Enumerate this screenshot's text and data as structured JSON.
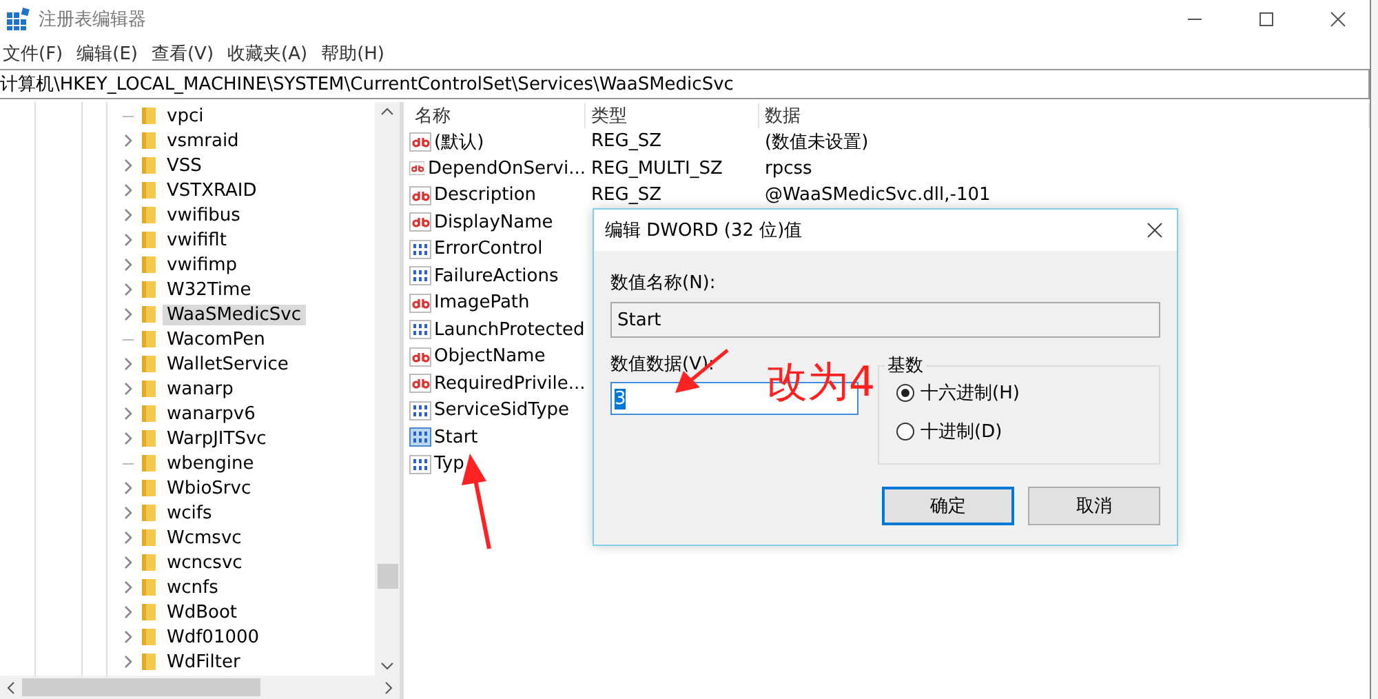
{
  "window": {
    "title": "注册表编辑器"
  },
  "menu": [
    "文件(F)",
    "编辑(E)",
    "查看(V)",
    "收藏夹(A)",
    "帮助(H)"
  ],
  "address": "计算机\\HKEY_LOCAL_MACHINE\\SYSTEM\\CurrentControlSet\\Services\\WaaSMedicSvc",
  "tree": [
    {
      "label": "vpci",
      "expandable": false,
      "selected": false
    },
    {
      "label": "vsmraid",
      "expandable": true,
      "selected": false
    },
    {
      "label": "VSS",
      "expandable": true,
      "selected": false
    },
    {
      "label": "VSTXRAID",
      "expandable": true,
      "selected": false
    },
    {
      "label": "vwifibus",
      "expandable": true,
      "selected": false
    },
    {
      "label": "vwififlt",
      "expandable": true,
      "selected": false
    },
    {
      "label": "vwifimp",
      "expandable": true,
      "selected": false
    },
    {
      "label": "W32Time",
      "expandable": true,
      "selected": false
    },
    {
      "label": "WaaSMedicSvc",
      "expandable": true,
      "selected": true
    },
    {
      "label": "WacomPen",
      "expandable": false,
      "selected": false
    },
    {
      "label": "WalletService",
      "expandable": true,
      "selected": false
    },
    {
      "label": "wanarp",
      "expandable": true,
      "selected": false
    },
    {
      "label": "wanarpv6",
      "expandable": true,
      "selected": false
    },
    {
      "label": "WarpJITSvc",
      "expandable": true,
      "selected": false
    },
    {
      "label": "wbengine",
      "expandable": false,
      "selected": false
    },
    {
      "label": "WbioSrvc",
      "expandable": true,
      "selected": false
    },
    {
      "label": "wcifs",
      "expandable": true,
      "selected": false
    },
    {
      "label": "Wcmsvc",
      "expandable": true,
      "selected": false
    },
    {
      "label": "wcncsvc",
      "expandable": true,
      "selected": false
    },
    {
      "label": "wcnfs",
      "expandable": true,
      "selected": false
    },
    {
      "label": "WdBoot",
      "expandable": true,
      "selected": false
    },
    {
      "label": "Wdf01000",
      "expandable": true,
      "selected": false
    },
    {
      "label": "WdFilter",
      "expandable": true,
      "selected": false
    }
  ],
  "list": {
    "columns": [
      "名称",
      "类型",
      "数据"
    ],
    "rows": [
      {
        "kind": "string",
        "name": "(默认)",
        "type": "REG_SZ",
        "data": "(数值未设置)",
        "selected": false
      },
      {
        "kind": "string",
        "name": "DependOnServi...",
        "type": "REG_MULTI_SZ",
        "data": "rpcss",
        "selected": false
      },
      {
        "kind": "string",
        "name": "Description",
        "type": "REG_SZ",
        "data": "@WaaSMedicSvc.dll,-101",
        "selected": false
      },
      {
        "kind": "string",
        "name": "DisplayName",
        "selected": false
      },
      {
        "kind": "binary",
        "name": "ErrorControl",
        "selected": false
      },
      {
        "kind": "binary",
        "name": "FailureActions",
        "selected": false
      },
      {
        "kind": "string",
        "name": "ImagePath",
        "selected": false
      },
      {
        "kind": "binary",
        "name": "LaunchProtected",
        "selected": false
      },
      {
        "kind": "string",
        "name": "ObjectName",
        "selected": false
      },
      {
        "kind": "string",
        "name": "RequiredPrivile...",
        "selected": false
      },
      {
        "kind": "binary",
        "name": "ServiceSidType",
        "selected": false
      },
      {
        "kind": "binary",
        "name": "Start",
        "selected": true
      },
      {
        "kind": "binary",
        "name": "Typ",
        "selected": false
      }
    ]
  },
  "dialog": {
    "title": "编辑 DWORD (32 位)值",
    "name_label": "数值名称(N):",
    "name_value": "Start",
    "data_label": "数值数据(V):",
    "data_value": "3",
    "base_label": "基数",
    "base_options": [
      {
        "label": "十六进制(H)",
        "selected": true
      },
      {
        "label": "十进制(D)",
        "selected": false
      }
    ],
    "buttons": [
      {
        "label": "确定",
        "default": true
      },
      {
        "label": "取消",
        "default": false
      }
    ]
  },
  "annotation": {
    "text": "改为4"
  }
}
